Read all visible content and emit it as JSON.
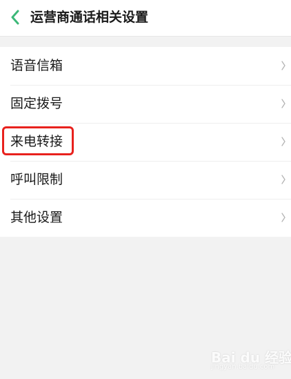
{
  "header": {
    "title": "运营商通话相关设置",
    "back_icon": "chevron-left-icon",
    "accent_color": "#3cb878"
  },
  "settings": {
    "items": [
      {
        "label": "语音信箱"
      },
      {
        "label": "固定拨号"
      },
      {
        "label": "来电转接",
        "highlighted": true,
        "highlight_color": "#e8211d"
      },
      {
        "label": "呼叫限制"
      },
      {
        "label": "其他设置"
      }
    ],
    "item_icon": "chevron-right-icon"
  },
  "watermark": {
    "text": "Bai du 经验",
    "sub": "jingyan.baidu.com"
  }
}
